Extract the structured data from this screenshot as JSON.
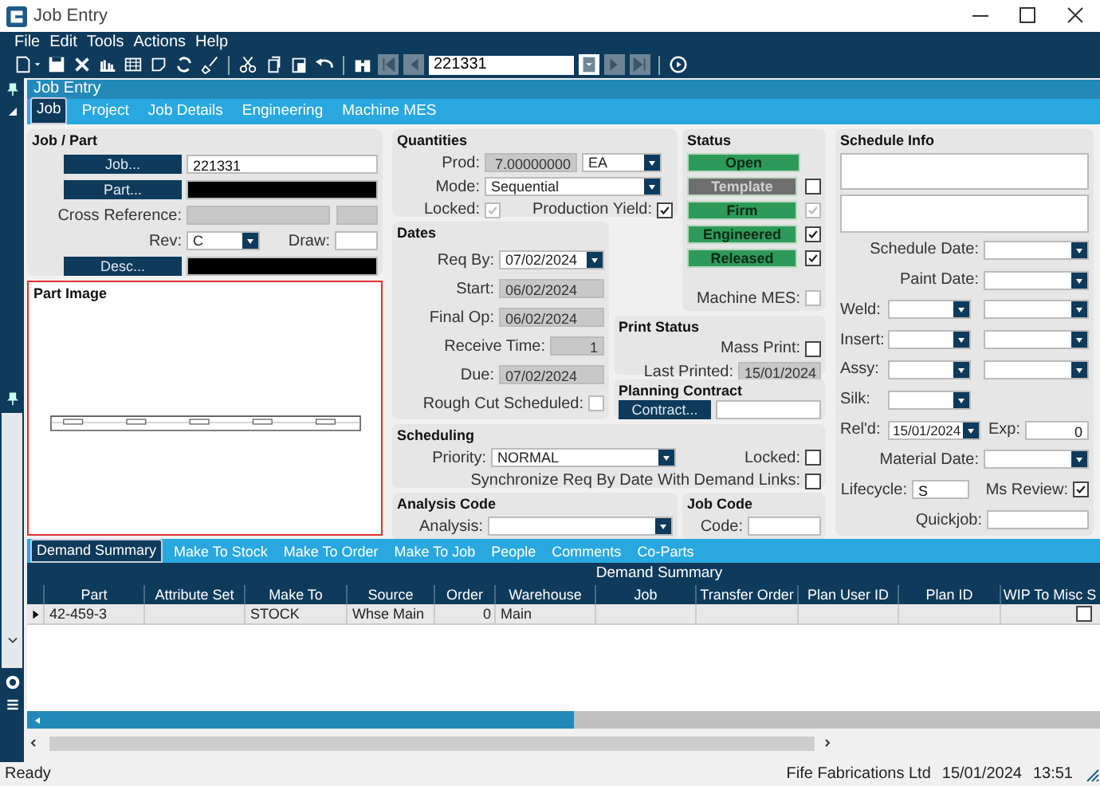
{
  "window": {
    "title": "Job Entry"
  },
  "menu": [
    "File",
    "Edit",
    "Tools",
    "Actions",
    "Help"
  ],
  "toolbar": {
    "record": "221331"
  },
  "panel_title": "Job Entry",
  "tabs": [
    {
      "label": "Job",
      "selected": true
    },
    {
      "label": "Project",
      "selected": false
    },
    {
      "label": "Job Details",
      "selected": false
    },
    {
      "label": "Engineering",
      "selected": false
    },
    {
      "label": "Machine MES",
      "selected": false
    }
  ],
  "job_part": {
    "title": "Job / Part",
    "job_button": "Job...",
    "job": "221331",
    "part_button": "Part...",
    "part_redacted": true,
    "cross_reference_label": "Cross Reference:",
    "rev_label": "Rev:",
    "rev": "C",
    "draw_label": "Draw:",
    "desc_button": "Desc...",
    "desc_redacted": true
  },
  "part_image": {
    "title": "Part Image"
  },
  "quantities": {
    "title": "Quantities",
    "prod_label": "Prod:",
    "prod": "7.00000000",
    "uom": "EA",
    "mode_label": "Mode:",
    "mode": "Sequential",
    "locked": {
      "label": "Locked:",
      "checked": true,
      "disabled": true
    },
    "production_yield": {
      "label": "Production Yield:",
      "checked": true,
      "disabled": false
    }
  },
  "dates": {
    "title": "Dates",
    "fields": [
      {
        "label": "Req By:",
        "value": "07/02/2024",
        "kind": "dropdown"
      },
      {
        "label": "Start:",
        "value": "06/02/2024",
        "kind": "readonly"
      },
      {
        "label": "Final Op:",
        "value": "06/02/2024",
        "kind": "readonly"
      },
      {
        "label": "Receive Time:",
        "value": "1",
        "kind": "number"
      },
      {
        "label": "Due:",
        "value": "07/02/2024",
        "kind": "readonly"
      }
    ],
    "rough_cut": {
      "label": "Rough Cut Scheduled:",
      "checked": false,
      "disabled": true
    }
  },
  "status": {
    "title": "Status",
    "open": "Open",
    "flags": [
      {
        "label": "Template",
        "active": false,
        "checked": false,
        "disabled": false
      },
      {
        "label": "Firm",
        "active": true,
        "checked": true,
        "disabled": true
      },
      {
        "label": "Engineered",
        "active": true,
        "checked": true,
        "disabled": false
      },
      {
        "label": "Released",
        "active": true,
        "checked": true,
        "disabled": false
      }
    ],
    "machine_mes": {
      "label": "Machine MES:",
      "checked": false,
      "disabled": true
    }
  },
  "print_status": {
    "title": "Print Status",
    "mass_print": {
      "label": "Mass Print:",
      "checked": false,
      "disabled": false
    },
    "last_printed_label": "Last Printed:",
    "last_printed": "15/01/2024"
  },
  "planning_contract": {
    "title": "Planning Contract",
    "button": "Contract..."
  },
  "scheduling": {
    "title": "Scheduling",
    "priority_label": "Priority:",
    "priority": "NORMAL",
    "locked": {
      "label": "Locked:",
      "checked": false,
      "disabled": false
    },
    "sync": {
      "label": "Synchronize Req By Date With Demand Links:",
      "checked": false,
      "disabled": false
    }
  },
  "analysis_code": {
    "title": "Analysis Code",
    "label": "Analysis:"
  },
  "job_code": {
    "title": "Job Code",
    "label": "Code:"
  },
  "schedule_info": {
    "title": "Schedule Info",
    "schedule_date_label": "Schedule Date:",
    "paint_date_label": "Paint Date:",
    "weld_label": "Weld:",
    "insert_label": "Insert:",
    "assy_label": "Assy:",
    "silk_label": "Silk:",
    "reld_label": "Rel'd:",
    "reld": "15/01/2024",
    "exp_label": "Exp:",
    "exp": "0",
    "material_date_label": "Material Date:",
    "lifecycle_label": "Lifecycle:",
    "lifecycle": "S",
    "ms_review": {
      "label": "Ms Review:",
      "checked": true,
      "disabled": false
    },
    "quickjob_label": "Quickjob:"
  },
  "bottom_tabs": [
    {
      "label": "Demand Summary",
      "selected": true
    },
    {
      "label": "Make To Stock",
      "selected": false
    },
    {
      "label": "Make To Order",
      "selected": false
    },
    {
      "label": "Make To Job",
      "selected": false
    },
    {
      "label": "People",
      "selected": false
    },
    {
      "label": "Comments",
      "selected": false
    },
    {
      "label": "Co-Parts",
      "selected": false
    }
  ],
  "demand_summary": {
    "title": "Demand Summary",
    "columns": [
      "Part",
      "Attribute Set",
      "Make To",
      "Source",
      "Order",
      "Warehouse",
      "Job",
      "Transfer Order",
      "Plan User ID",
      "Plan ID",
      "WIP To Misc S"
    ],
    "rows": [
      {
        "part": "42-459-3",
        "make_to": "STOCK",
        "source": "Whse Main",
        "order": "0",
        "warehouse": "Main",
        "wip_to_misc": false
      }
    ]
  },
  "status_bar": {
    "text": "Ready",
    "company": "Fife Fabrications Ltd",
    "date": "15/01/2024",
    "time": "13:51"
  }
}
